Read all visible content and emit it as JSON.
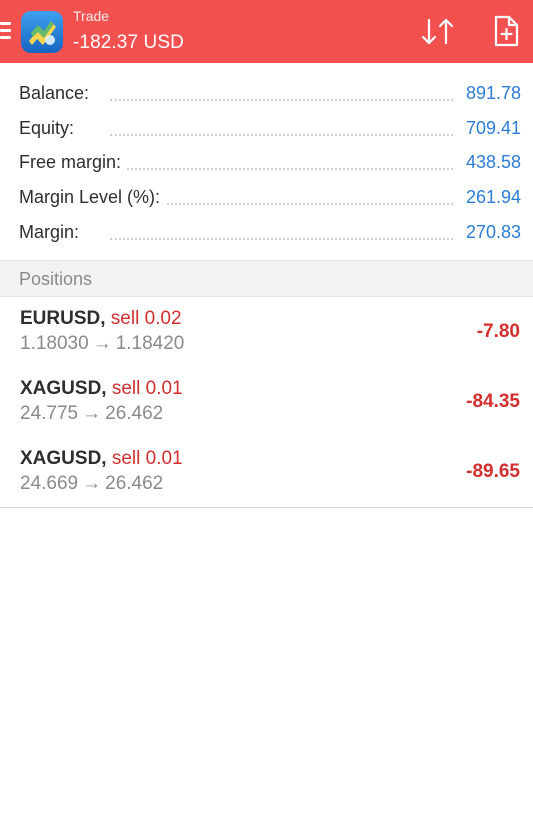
{
  "header": {
    "title": "Trade",
    "amount": "-182.37 USD",
    "menu_icon": "hamburger-menu-icon",
    "logo_icon": "metatrader-logo-icon",
    "sort_icon": "sort-arrows-icon",
    "new_order_icon": "new-order-icon",
    "background": "#f35050"
  },
  "summary": [
    {
      "label": "Balance:",
      "value": "891.78"
    },
    {
      "label": "Equity:",
      "value": "709.41"
    },
    {
      "label": "Free margin:",
      "value": "438.58"
    },
    {
      "label": "Margin Level (%):",
      "value": "261.94"
    },
    {
      "label": "Margin:",
      "value": "270.83"
    }
  ],
  "positions_header": "Positions",
  "positions": [
    {
      "symbol": "EURUSD",
      "side": "sell 0.02",
      "open_price": "1.18030",
      "arrow": "→",
      "current_price": "1.18420",
      "profit": "-7.80"
    },
    {
      "symbol": "XAGUSD",
      "side": "sell 0.01",
      "open_price": "24.775",
      "arrow": "→",
      "current_price": "26.462",
      "profit": "-84.35"
    },
    {
      "symbol": "XAGUSD",
      "side": "sell 0.01",
      "open_price": "24.669",
      "arrow": "→",
      "current_price": "26.462",
      "profit": "-89.65"
    }
  ],
  "colors": {
    "accent_blue": "#2b7dd8",
    "loss_red": "#d32f2f",
    "muted_gray": "#8a8a8a"
  }
}
